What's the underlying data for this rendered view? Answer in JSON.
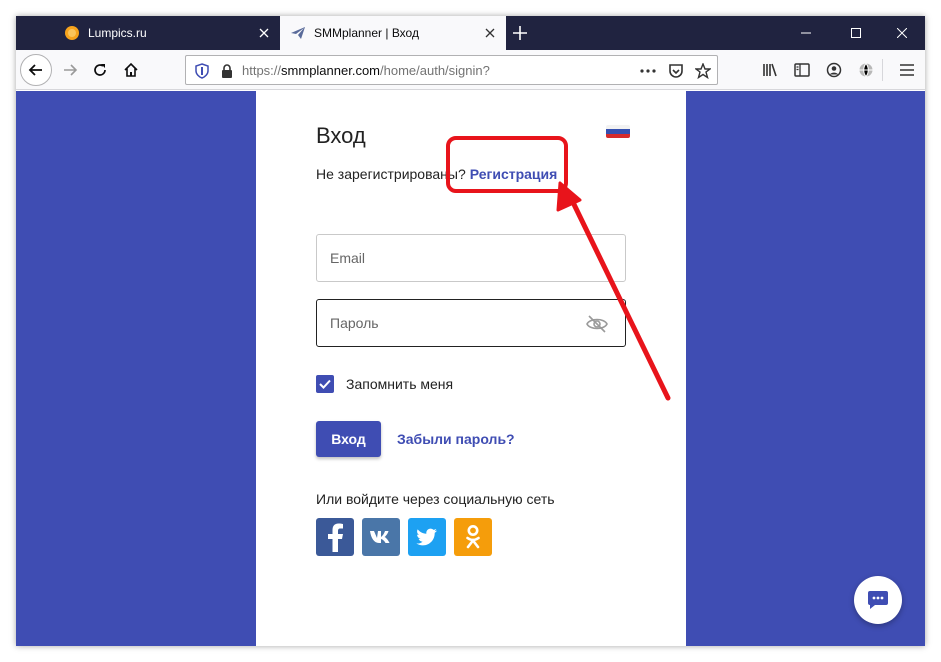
{
  "browser": {
    "tabs": [
      {
        "title": "Lumpics.ru",
        "favicon": "orange-circle-icon",
        "active": false
      },
      {
        "title": "SMMplanner | Вход",
        "favicon": "paper-plane-icon",
        "active": true
      }
    ],
    "url": {
      "scheme": "https://",
      "host": "smmplanner.com",
      "path": "/home/auth/signin?"
    }
  },
  "page": {
    "title": "Вход",
    "flag": "russia-flag-icon",
    "register_prefix": "Не зарегистрированы?",
    "register_link": "Регистрация",
    "email_placeholder": "Email",
    "password_placeholder": "Пароль",
    "remember_label": "Запомнить меня",
    "remember_checked": true,
    "login_button": "Вход",
    "forgot_link": "Забыли пароль?",
    "social_title": "Или войдите через социальную сеть",
    "social": [
      "facebook-icon",
      "vk-icon",
      "twitter-icon",
      "odnoklassniki-icon"
    ]
  },
  "colors": {
    "brand": "#3f4db3",
    "tabbar": "#202340",
    "annotation": "#e8141b"
  }
}
